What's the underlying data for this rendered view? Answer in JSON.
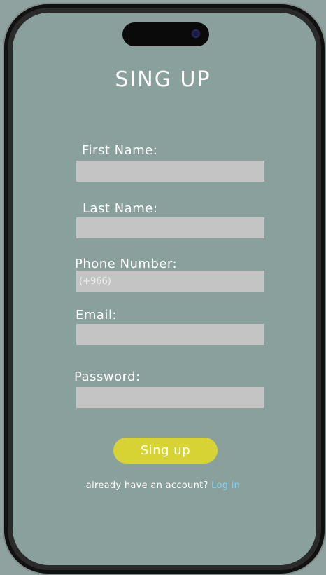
{
  "screen": {
    "title": "SING UP"
  },
  "form": {
    "first_name_label": "First Name:",
    "last_name_label": "Last Name:",
    "phone_label": "Phone Number:",
    "phone_placeholder": "(+966)",
    "email_label": "Email:",
    "password_label": "Password:",
    "submit_label": "Sing up"
  },
  "footer": {
    "prompt": "already have an account?",
    "login_link": "Log in"
  },
  "colors": {
    "screen_bg": "#8aa09d",
    "input_bg": "#c4c4c4",
    "button_bg": "#d7d335",
    "link": "#7fd3f0"
  }
}
